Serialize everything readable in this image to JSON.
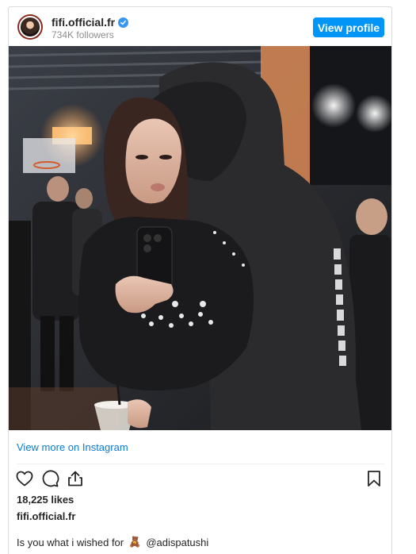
{
  "header": {
    "username": "fifi.official.fr",
    "followers": "734K followers",
    "view_profile_label": "View profile"
  },
  "post": {
    "view_more_label": "View more on Instagram",
    "likes": "18,225 likes",
    "username": "fifi.official.fr",
    "caption_text": "Is you what i wished for",
    "caption_emoji": "🧸",
    "caption_mention": "@adispatushi"
  },
  "icons": {
    "verified": "verified-badge-icon",
    "like": "heart-icon",
    "comment": "comment-icon",
    "share": "share-icon",
    "save": "bookmark-icon"
  },
  "colors": {
    "accent": "#0095f6",
    "link": "#0a7bd1",
    "verified": "#3897f0",
    "text": "#262626",
    "muted": "#8e8e8e",
    "border": "#dbdbdb"
  }
}
